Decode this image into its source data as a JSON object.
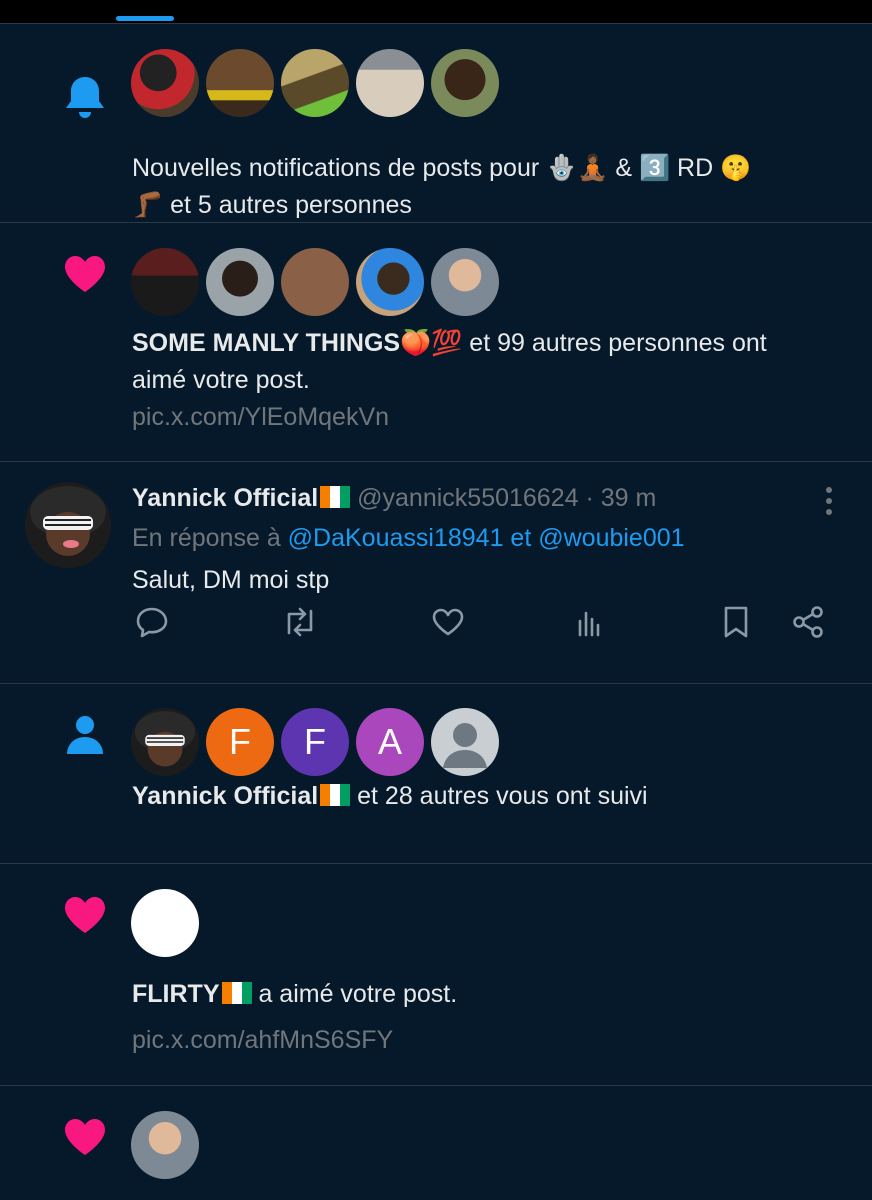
{
  "colors": {
    "background": "#06192a",
    "accent": "#1d9bf0",
    "like": "#f91880",
    "muted": "#71767b",
    "text": "#e7e9ea",
    "divider": "#2c3a47"
  },
  "notifications": [
    {
      "type": "bell-icon",
      "avatars": [
        "avatar-1",
        "avatar-2",
        "avatar-3",
        "avatar-4",
        "avatar-5"
      ],
      "text_line1": "Nouvelles notifications de posts pour 🪬🧘🏾 & 3️⃣ RD 🤫",
      "text_line2": "🦵🏾 et 5 autres personnes"
    },
    {
      "type": "heart-icon",
      "avatars": [
        "avatar-1",
        "avatar-2",
        "avatar-3",
        "avatar-4",
        "avatar-5"
      ],
      "name": "SOME MANLY THINGS🍑💯",
      "text_rest": " et 99 autres personnes ont",
      "text_line2": "aimé votre post.",
      "link": "pic.x.com/YlEoMqekVn"
    },
    {
      "type": "tweet",
      "name": "Yannick Official",
      "handle": "@yannick55016624",
      "time": "· 39 m",
      "reply_prefix": "En réponse à",
      "reply_mention_1": "@DaKouassi18941",
      "reply_joiner": "et",
      "reply_mention_2": "@woubie001",
      "body": "Salut, DM moi stp"
    },
    {
      "type": "person-icon",
      "avatars": [
        {
          "kind": "photo"
        },
        {
          "kind": "letter",
          "letter": "F",
          "color": "#ee6a12"
        },
        {
          "kind": "letter",
          "letter": "F",
          "color": "#5e35b1"
        },
        {
          "kind": "letter",
          "letter": "A",
          "color": "#ab47bc"
        },
        {
          "kind": "default"
        }
      ],
      "name": "Yannick Official",
      "text_rest": " et 28 autres vous ont suivi"
    },
    {
      "type": "heart-icon",
      "name": "FLIRTY",
      "text_rest": " a aimé votre post.",
      "link": "pic.x.com/ahfMnS6SFY"
    },
    {
      "type": "heart-icon"
    }
  ]
}
